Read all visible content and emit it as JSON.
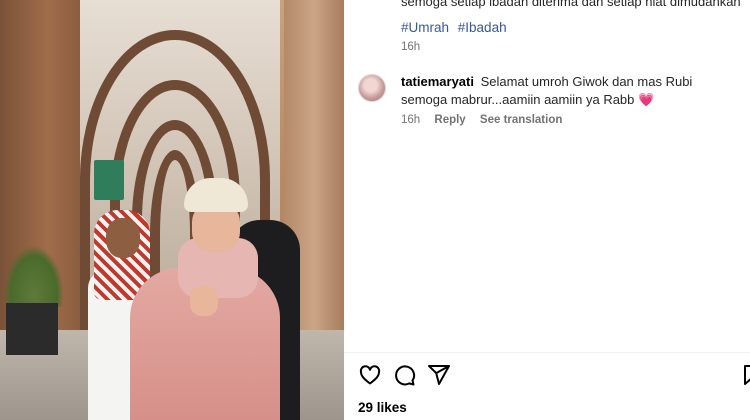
{
  "post": {
    "caption_tail": "semoga setiap ibadah diterima dan setiap niat dimudahkan",
    "hashtags": [
      "#Umrah",
      "#Ibadah"
    ],
    "time": "16h"
  },
  "comment": {
    "username": "tatiemaryati",
    "text": "Selamat umroh Giwok dan mas Rubi semoga mabrur...aamiin aamiin ya Rabb",
    "emoji": "💗",
    "time": "16h",
    "reply_label": "Reply",
    "translation_label": "See translation"
  },
  "actions": {
    "like_icon": "heart-icon",
    "comment_icon": "comment-icon",
    "share_icon": "share-icon",
    "save_icon": "bookmark-icon"
  },
  "likes": "29 likes",
  "colors": {
    "hashtag": "#385898",
    "muted": "#737373",
    "heart_emoji": "#e0245e"
  }
}
